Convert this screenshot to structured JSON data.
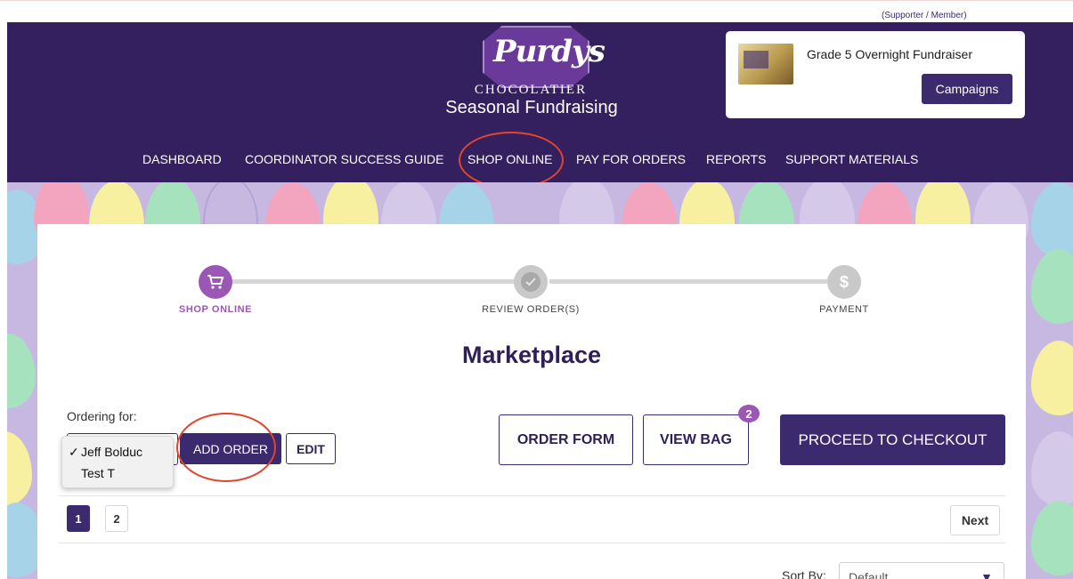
{
  "top": {
    "supporter_link": "(Supporter / Member)"
  },
  "brand": {
    "script": "Purdys",
    "chocolatier": "CHOCOLATIER",
    "tagline": "Seasonal Fundraising"
  },
  "campaign": {
    "title": "Grade 5 Overnight Fundraiser",
    "button": "Campaigns"
  },
  "nav": {
    "items": [
      "DASHBOARD",
      "COORDINATOR SUCCESS GUIDE",
      "SHOP ONLINE",
      "PAY FOR ORDERS",
      "REPORTS",
      "SUPPORT MATERIALS"
    ]
  },
  "steps": [
    {
      "label": "SHOP ONLINE",
      "icon": "cart-icon",
      "active": true
    },
    {
      "label": "REVIEW ORDER(S)",
      "icon": "check-icon",
      "active": false
    },
    {
      "label": "PAYMENT",
      "icon": "dollar-icon",
      "active": false
    }
  ],
  "page": {
    "title": "Marketplace"
  },
  "ordering": {
    "label": "Ordering for:",
    "options": [
      "Jeff Bolduc",
      "Test T"
    ],
    "selected": "Jeff Bolduc",
    "add_order": "ADD ORDER",
    "edit": "EDIT"
  },
  "actions": {
    "order_form": "ORDER FORM",
    "view_bag": "VIEW BAG",
    "bag_count": "2",
    "checkout": "PROCEED TO CHECKOUT"
  },
  "pagination": {
    "pages": [
      "1",
      "2"
    ],
    "current": "1",
    "next": "Next"
  },
  "sort": {
    "label": "Sort By:",
    "value": "Default"
  },
  "colors": {
    "brand_purple": "#35205f",
    "accent_purple": "#9b57b4",
    "annotation_red": "#e0452e"
  }
}
